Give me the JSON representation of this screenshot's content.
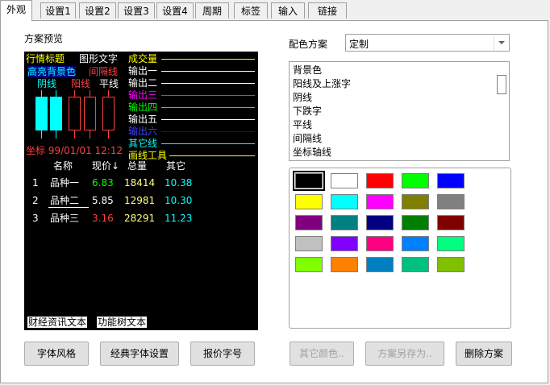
{
  "tabs": [
    "外观",
    "设置1",
    "设置2",
    "设置3",
    "设置4",
    "周期",
    "标签",
    "输入",
    "链接"
  ],
  "preview": {
    "section_label": "方案预览",
    "header": "行情标题",
    "graphic_text": "图形文字",
    "high_bg": "高亮背景色",
    "gap_line": "间隔线",
    "yin": "阴线",
    "yang": "阳线",
    "flat": "平线",
    "indicator_labels": [
      "成交量",
      "输出一",
      "输出二",
      "输出三",
      "输出四",
      "输出五",
      "输出六",
      "其它线",
      "画线工具"
    ],
    "coord": "坐标 99/01/01 12:12",
    "table_headers": [
      "名称",
      "现价↓",
      "总量",
      "其它"
    ],
    "rows": [
      {
        "idx": "1",
        "name": "品种一",
        "price": "6.83",
        "vol": "18414",
        "other": "10.38"
      },
      {
        "idx": "2",
        "name": "品种二",
        "price": "5.85",
        "vol": "12981",
        "other": "10.30"
      },
      {
        "idx": "3",
        "name": "品种三",
        "price": "3.16",
        "vol": "28291",
        "other": "11.23"
      }
    ],
    "finance_text": "财经资讯文本",
    "func_tree_text": "功能树文本"
  },
  "scheme": {
    "label": "配色方案",
    "selected": "定制",
    "items": [
      "背景色",
      "阳线及上涨字",
      "阴线",
      "下跌字",
      "平线",
      "间隔线",
      "坐标轴线"
    ]
  },
  "colors": {
    "palette": [
      "#000000",
      "#ffffff",
      "#ff0000",
      "#00ff00",
      "#0000ff",
      "#ffff00",
      "#00ffff",
      "#ff00ff",
      "#808000",
      "#808080",
      "#800080",
      "#008080",
      "#000080",
      "#008000",
      "#800000",
      "#c0c0c0",
      "#8000ff",
      "#ff0080",
      "#0080ff",
      "#00ff80",
      "#80ff00",
      "#ff8000",
      "#0080c0",
      "#00c080",
      "#80c000"
    ],
    "indicator": [
      "#ffff00",
      "#ffffff",
      "#ffffff",
      "#ff00ff",
      "#00ff00",
      "#ffffff",
      "#0000ff",
      "#00ffff",
      "#ffff00"
    ]
  },
  "buttons": {
    "font_style": "字体风格",
    "classic_font": "经典字体设置",
    "quote_font": "报价字号",
    "other_color": "其它颜色..",
    "save_as": "方案另存为..",
    "delete": "删除方案"
  }
}
